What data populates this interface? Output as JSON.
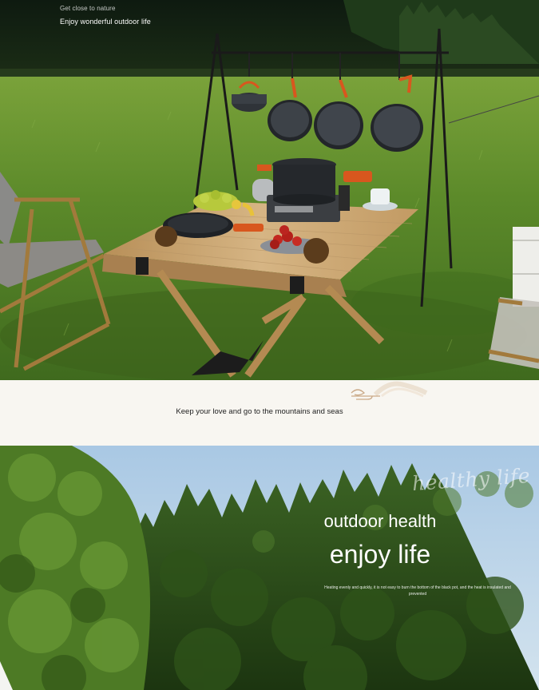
{
  "hero": {
    "subtitle": "Get close to nature",
    "title": "Enjoy wonderful outdoor life"
  },
  "band": {
    "text": "Keep your love and go to the mountains and seas"
  },
  "forest": {
    "script_text": "healthy life",
    "heading_small": "outdoor health",
    "heading_large": "enjoy life",
    "description": "Heating evenly and quickly, it is not easy to burn the bottom of the black pot, and the heat is insulated and prevented"
  },
  "colors": {
    "grass": "#5f8a2c",
    "table_wood": "#c9a774",
    "cookware": "#2a2d31",
    "handle_orange": "#d8571e",
    "sky": "#b9d3e8",
    "forest_dark": "#243f17"
  },
  "icons": [
    "cloud-ornament-icon"
  ]
}
